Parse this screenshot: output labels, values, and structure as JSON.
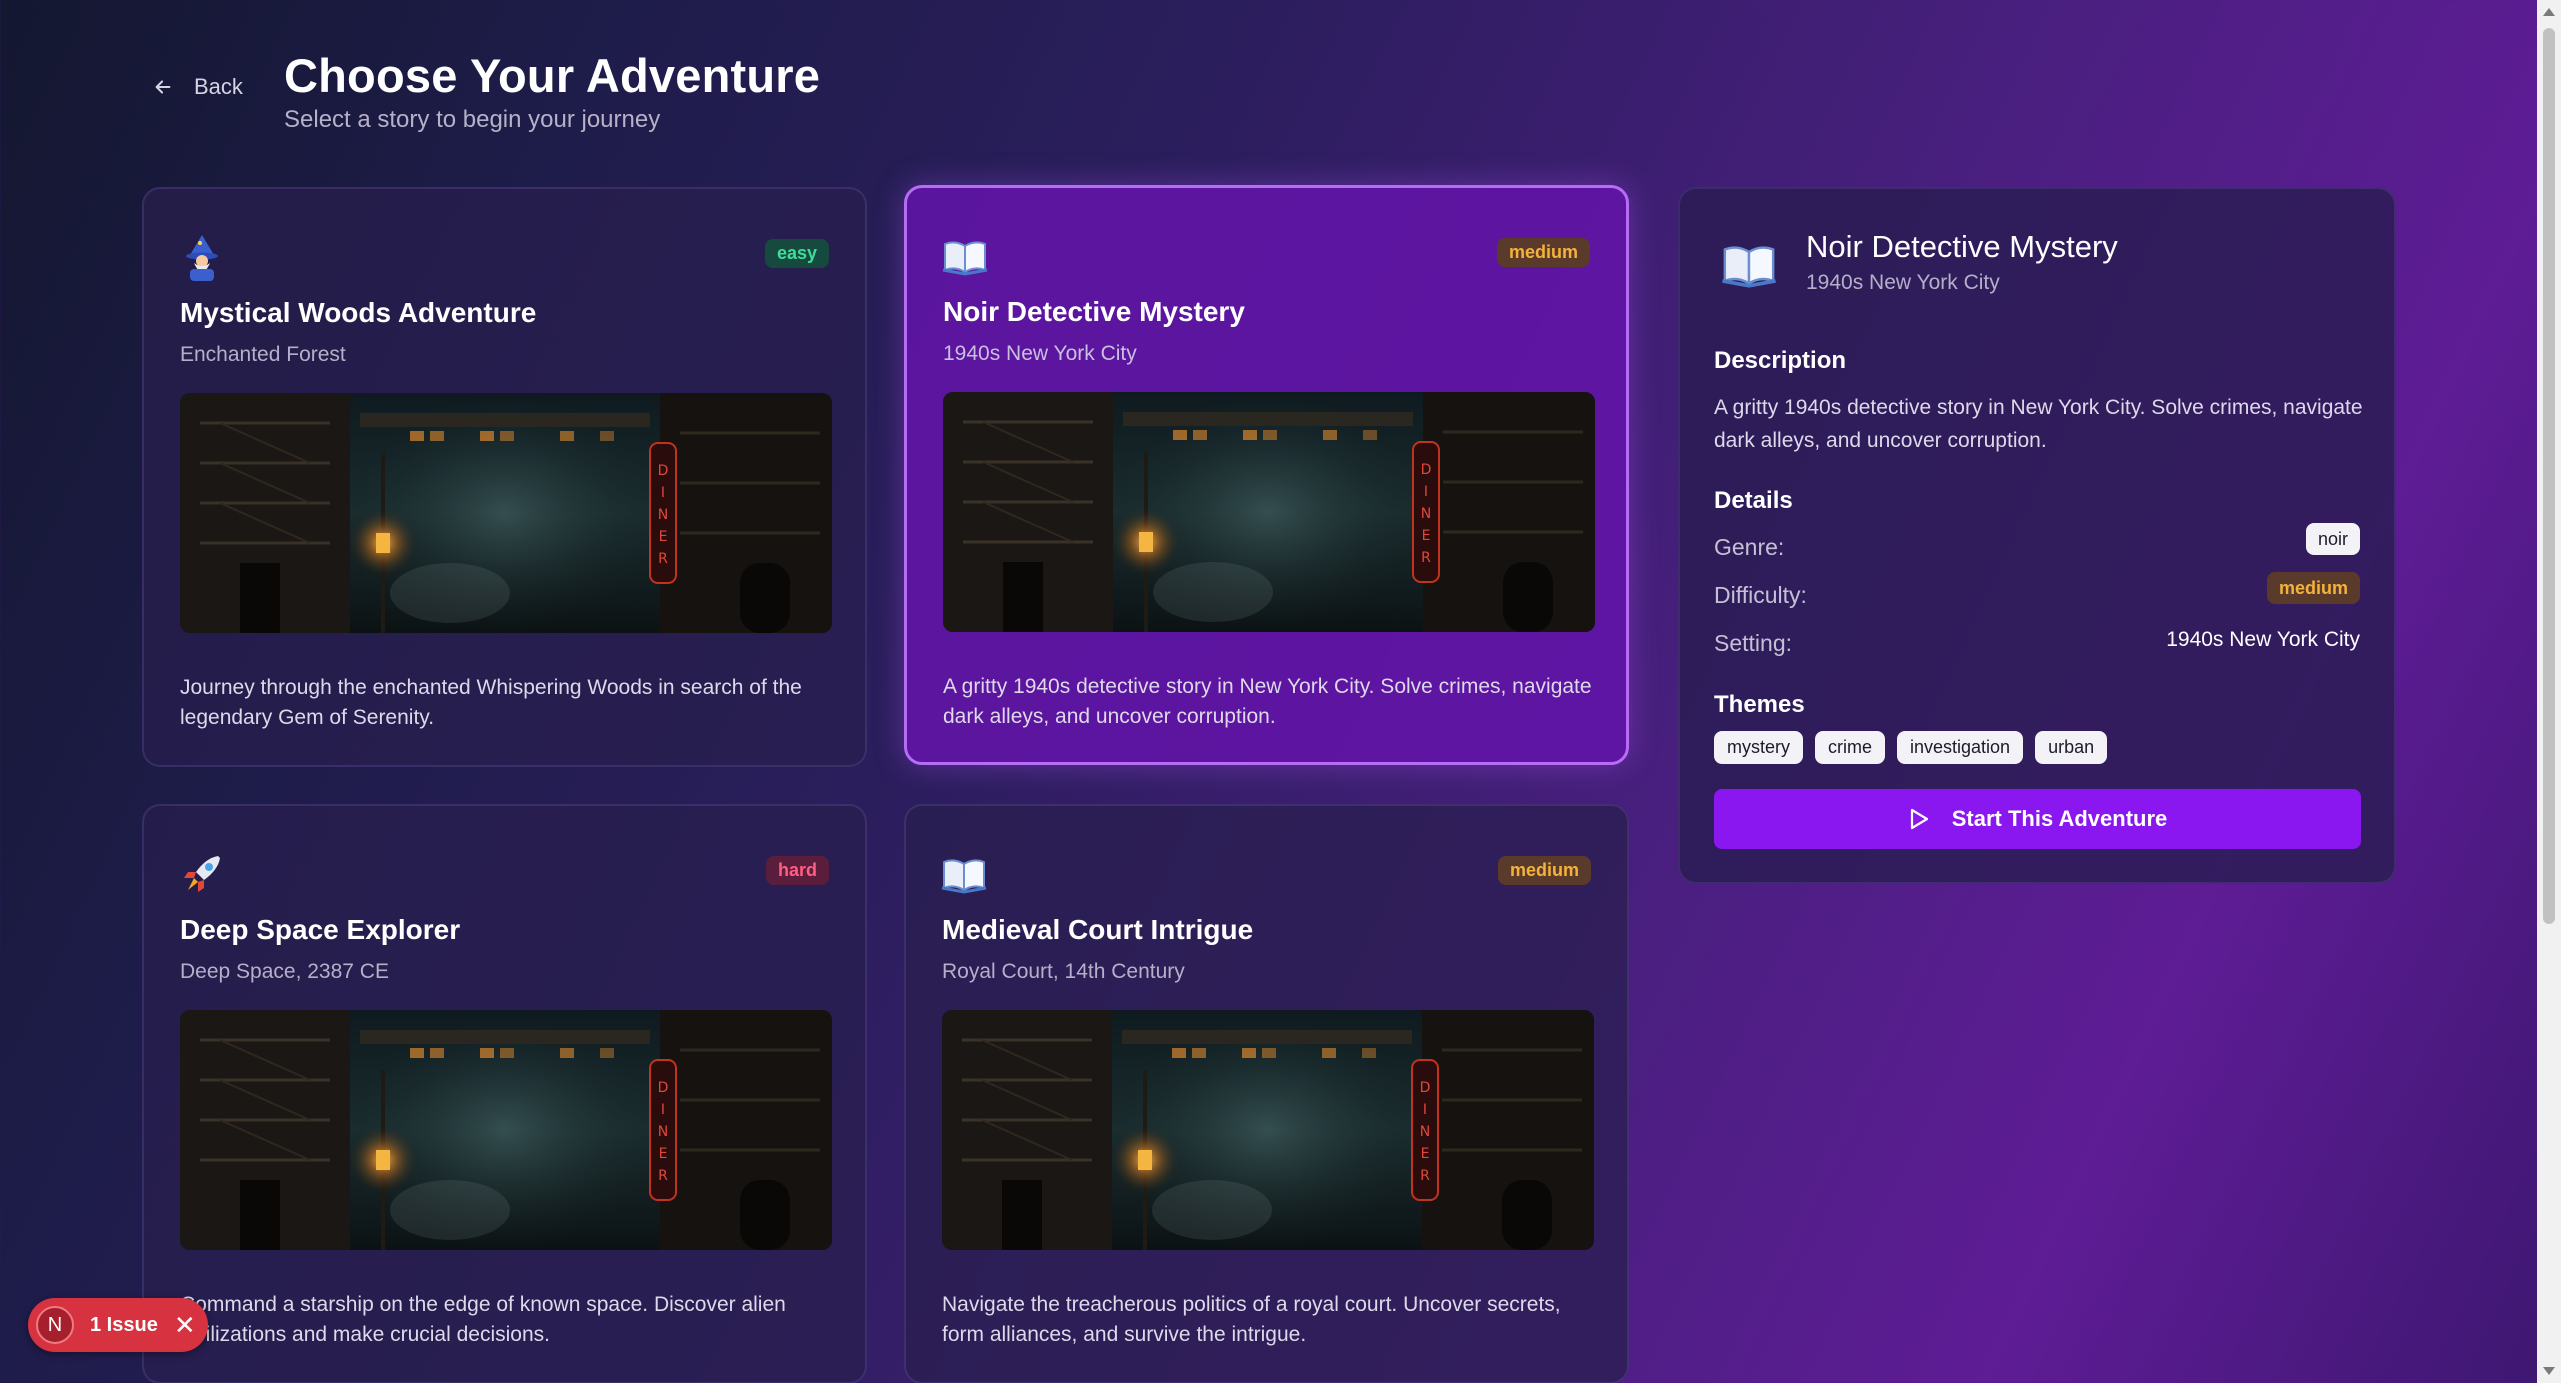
{
  "header": {
    "back_label": "Back",
    "title": "Choose Your Adventure",
    "subtitle": "Select a story to begin your journey"
  },
  "cards": [
    {
      "icon": "wizard-emoji",
      "badge": "easy",
      "title": "Mystical Woods Adventure",
      "setting": "Enchanted Forest",
      "scene_sign": "DINER",
      "description": "Journey through the enchanted Whispering Woods in search of the legendary Gem of Serenity."
    },
    {
      "icon": "open-book-emoji",
      "badge": "medium",
      "title": "Noir Detective Mystery",
      "setting": "1940s New York City",
      "scene_sign": "DINER",
      "description": "A gritty 1940s detective story in New York City. Solve crimes, navigate dark alleys, and uncover corruption.",
      "selected": true
    },
    {
      "icon": "rocket-emoji",
      "badge": "hard",
      "title": "Deep Space Explorer",
      "setting": "Deep Space, 2387 CE",
      "scene_sign": "DINER",
      "description": "Command a starship on the edge of known space. Discover alien civilizations and make crucial decisions."
    },
    {
      "icon": "open-book-emoji",
      "badge": "medium",
      "title": "Medieval Court Intrigue",
      "setting": "Royal Court, 14th Century",
      "scene_sign": "DINER",
      "description": "Navigate the treacherous politics of a royal court. Uncover secrets, form alliances, and survive the intrigue."
    }
  ],
  "detail": {
    "title": "Noir Detective Mystery",
    "setting": "1940s New York City",
    "description_heading": "Description",
    "description": "A gritty 1940s detective story in New York City. Solve crimes, navigate dark alleys, and uncover corruption.",
    "details_heading": "Details",
    "genre_label": "Genre:",
    "genre_value": "noir",
    "difficulty_label": "Difficulty:",
    "difficulty_value": "medium",
    "setting_label": "Setting:",
    "setting_value": "1940s New York City",
    "themes_heading": "Themes",
    "themes": [
      "mystery",
      "crime",
      "investigation",
      "urban"
    ],
    "start_label": "Start This Adventure"
  },
  "issue_badge": {
    "letter": "N",
    "label": "1 Issue"
  },
  "colors": {
    "accent": "#8a17f0",
    "selected_border": "#b66cf5",
    "easy": "#3fdc9a",
    "medium": "#f3b23b",
    "hard": "#ff5d82"
  }
}
